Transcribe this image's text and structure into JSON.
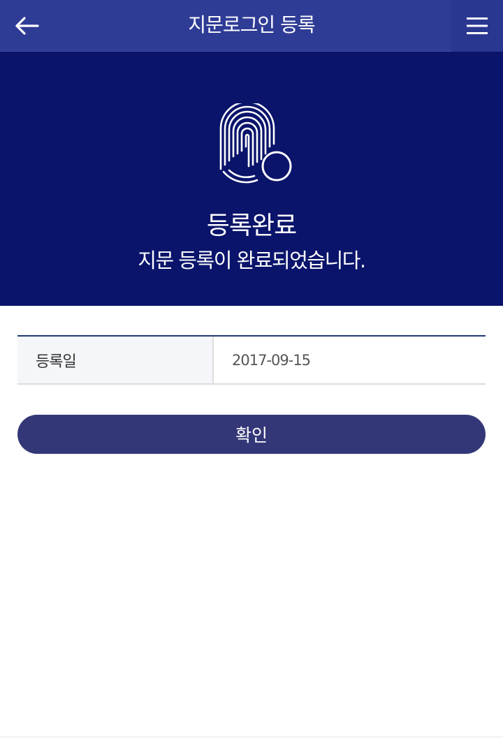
{
  "header": {
    "title": "지문로그인 등록",
    "back_icon": "arrow-left-icon",
    "menu_icon": "hamburger-menu-icon"
  },
  "hero": {
    "icon": "fingerprint-icon",
    "title": "등록완료",
    "subtitle": "지문 등록이 완료되었습니다."
  },
  "info": {
    "label": "등록일",
    "value": "2017-09-15"
  },
  "confirm_button": {
    "label": "확인"
  },
  "colors": {
    "header_bg": "#2f3c96",
    "hero_bg": "#0a146b",
    "button_bg": "#343777"
  }
}
